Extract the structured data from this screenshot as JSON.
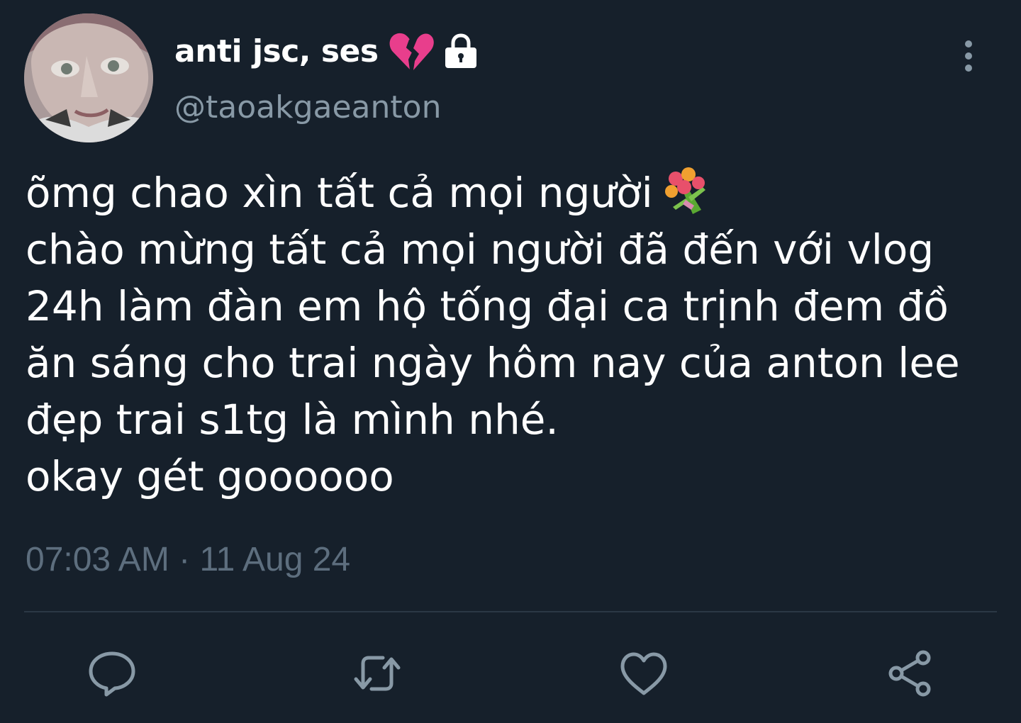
{
  "author": {
    "display_name": "anti jsc, ses",
    "handle": "@taoakgaeanton",
    "badge_emoji_icon": "broken-heart-icon",
    "protected_icon": "lock-icon"
  },
  "tweet": {
    "lines": [
      "õmg chao xìn tất cả mọi người",
      "chào mừng tất cả mọi người đã đến với vlog",
      "24h làm đàn em hộ tống đại ca trịnh đem đồ",
      "ăn sáng cho trai ngày hôm nay của anton lee",
      "đẹp trai s1tg là mình nhé.",
      "okay gét goooooo"
    ],
    "emoji_icon": "bouquet-icon",
    "timestamp": "07:03 AM · 11 Aug 24"
  },
  "actions": [
    {
      "name": "reply",
      "icon": "reply-icon"
    },
    {
      "name": "retweet",
      "icon": "retweet-icon"
    },
    {
      "name": "like",
      "icon": "heart-icon"
    },
    {
      "name": "share",
      "icon": "share-icon"
    }
  ],
  "colors": {
    "background": "#16202b",
    "primary_text": "#ffffff",
    "secondary_text": "#8899a6",
    "timestamp_text": "#5d6e7e",
    "icon": "#8899a6",
    "divider": "#2b3845"
  }
}
